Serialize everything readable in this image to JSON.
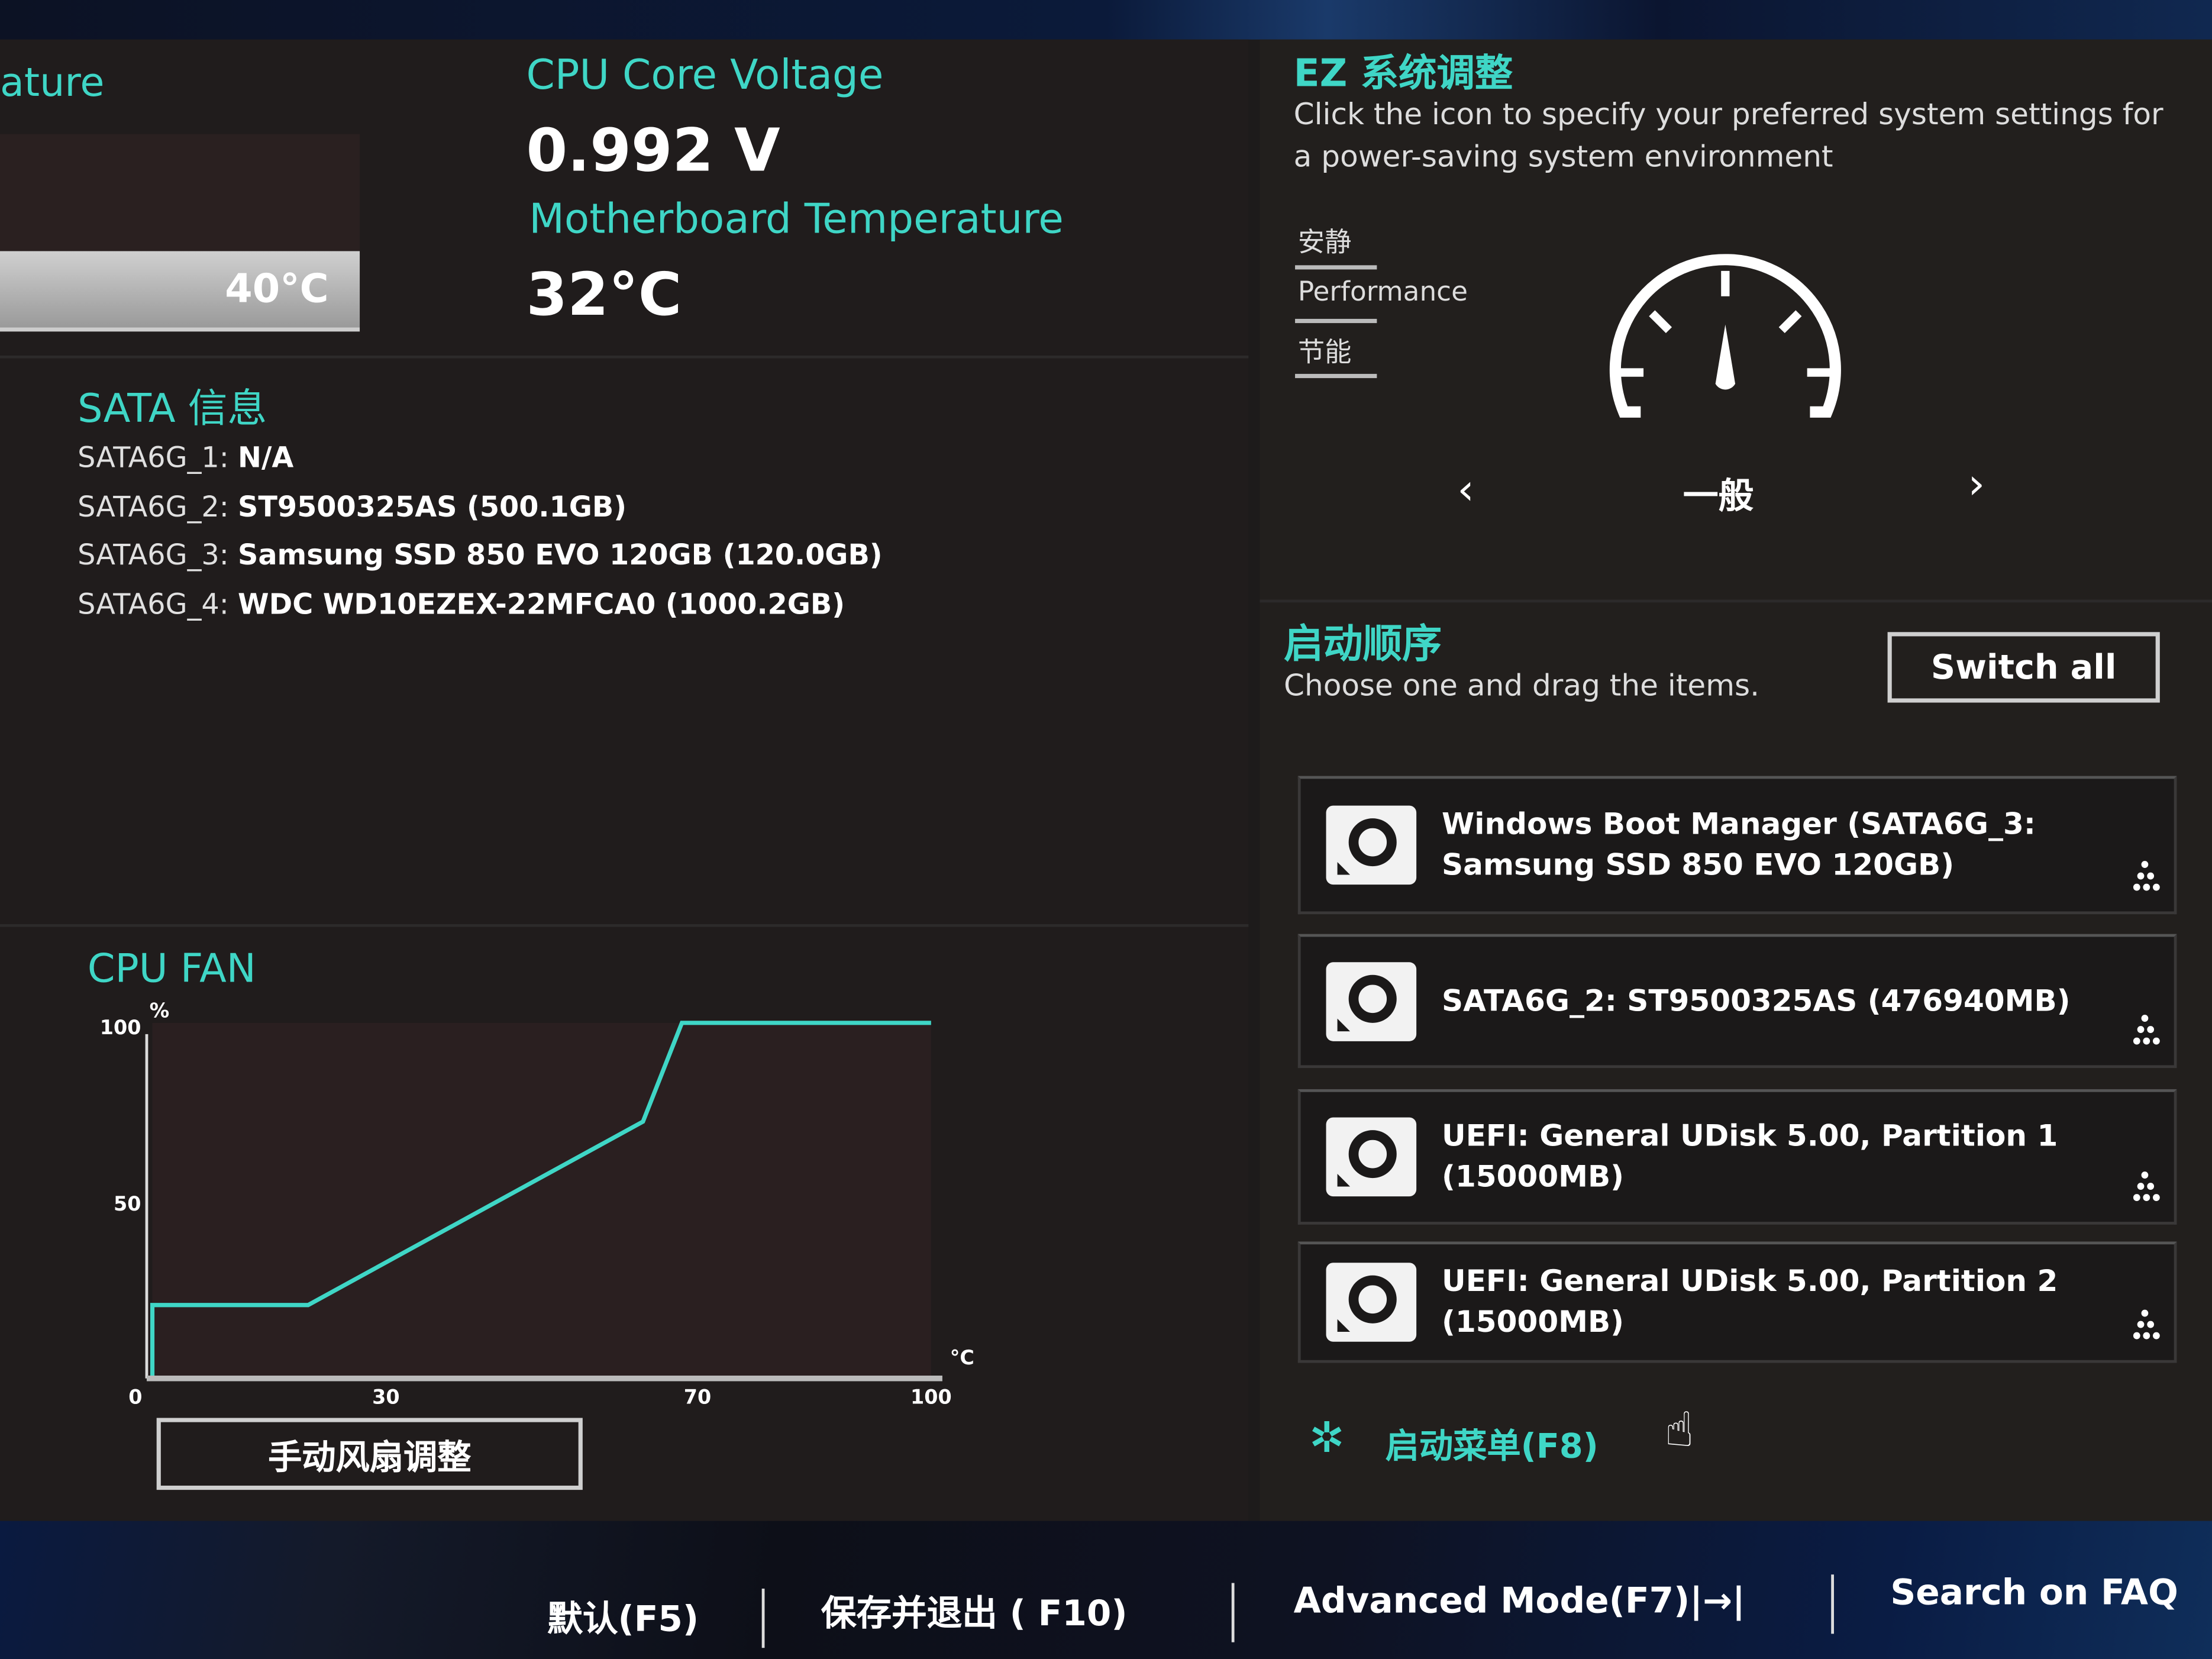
{
  "colors": {
    "accent": "#3fd6c6",
    "background": "#1d1b1b",
    "text": "#ffffff"
  },
  "cpu_temperature": {
    "label_partial": "ature",
    "value": "40°C"
  },
  "voltage": {
    "label": "CPU Core Voltage",
    "value": "0.992 V"
  },
  "mb_temperature": {
    "label": "Motherboard Temperature",
    "value": "32°C"
  },
  "sata": {
    "title": "SATA 信息",
    "ports": [
      {
        "port": "SATA6G_1:",
        "device": "N/A"
      },
      {
        "port": "SATA6G_2:",
        "device": "ST9500325AS (500.1GB)"
      },
      {
        "port": "SATA6G_3:",
        "device": "Samsung SSD 850 EVO 120GB (120.0GB)"
      },
      {
        "port": "SATA6G_4:",
        "device": "WDC WD10EZEX-22MFCA0 (1000.2GB)"
      }
    ]
  },
  "cpu_fan": {
    "title": "CPU FAN",
    "manual_button": "手动风扇调整"
  },
  "chart_data": {
    "type": "line",
    "title": "CPU FAN",
    "xlabel": "°C",
    "ylabel": "%",
    "xlim": [
      0,
      100
    ],
    "ylim": [
      0,
      100
    ],
    "x_ticks": [
      "0",
      "30",
      "70",
      "100"
    ],
    "y_ticks": [
      "100",
      "50"
    ],
    "series": [
      {
        "x": [
          0,
          0,
          20,
          63,
          68,
          100
        ],
        "y": [
          0,
          20,
          20,
          72,
          100,
          100
        ]
      }
    ],
    "color": "#3fd6c6"
  },
  "ez_tuning": {
    "title": "EZ 系统调整",
    "description": "Click the icon to specify your preferred system settings for a power-saving system environment",
    "options": [
      "安静",
      "Performance",
      "节能"
    ],
    "current_mode": "一般",
    "prev_label": "‹",
    "next_label": "›",
    "icon": "speedometer-icon"
  },
  "boot": {
    "title": "启动顺序",
    "hint": "Choose one and drag the items.",
    "switch_all": "Switch all",
    "items": [
      {
        "line1": "Windows Boot Manager (SATA6G_3:",
        "line2": "Samsung SSD 850 EVO 120GB)"
      },
      {
        "line1": "SATA6G_2: ST9500325AS  (476940MB)",
        "line2": ""
      },
      {
        "line1": "UEFI: General UDisk 5.00, Partition 1",
        "line2": "(15000MB)"
      },
      {
        "line1": "UEFI: General UDisk 5.00, Partition 2",
        "line2": "(15000MB)"
      }
    ],
    "boot_menu": "启动菜单(F8)"
  },
  "footer": {
    "default": "默认(F5)",
    "save_exit": "保存并退出 ( F10)",
    "advanced": "Advanced Mode(F7)|",
    "advanced_icon": "→|",
    "faq": "Search on FAQ"
  }
}
